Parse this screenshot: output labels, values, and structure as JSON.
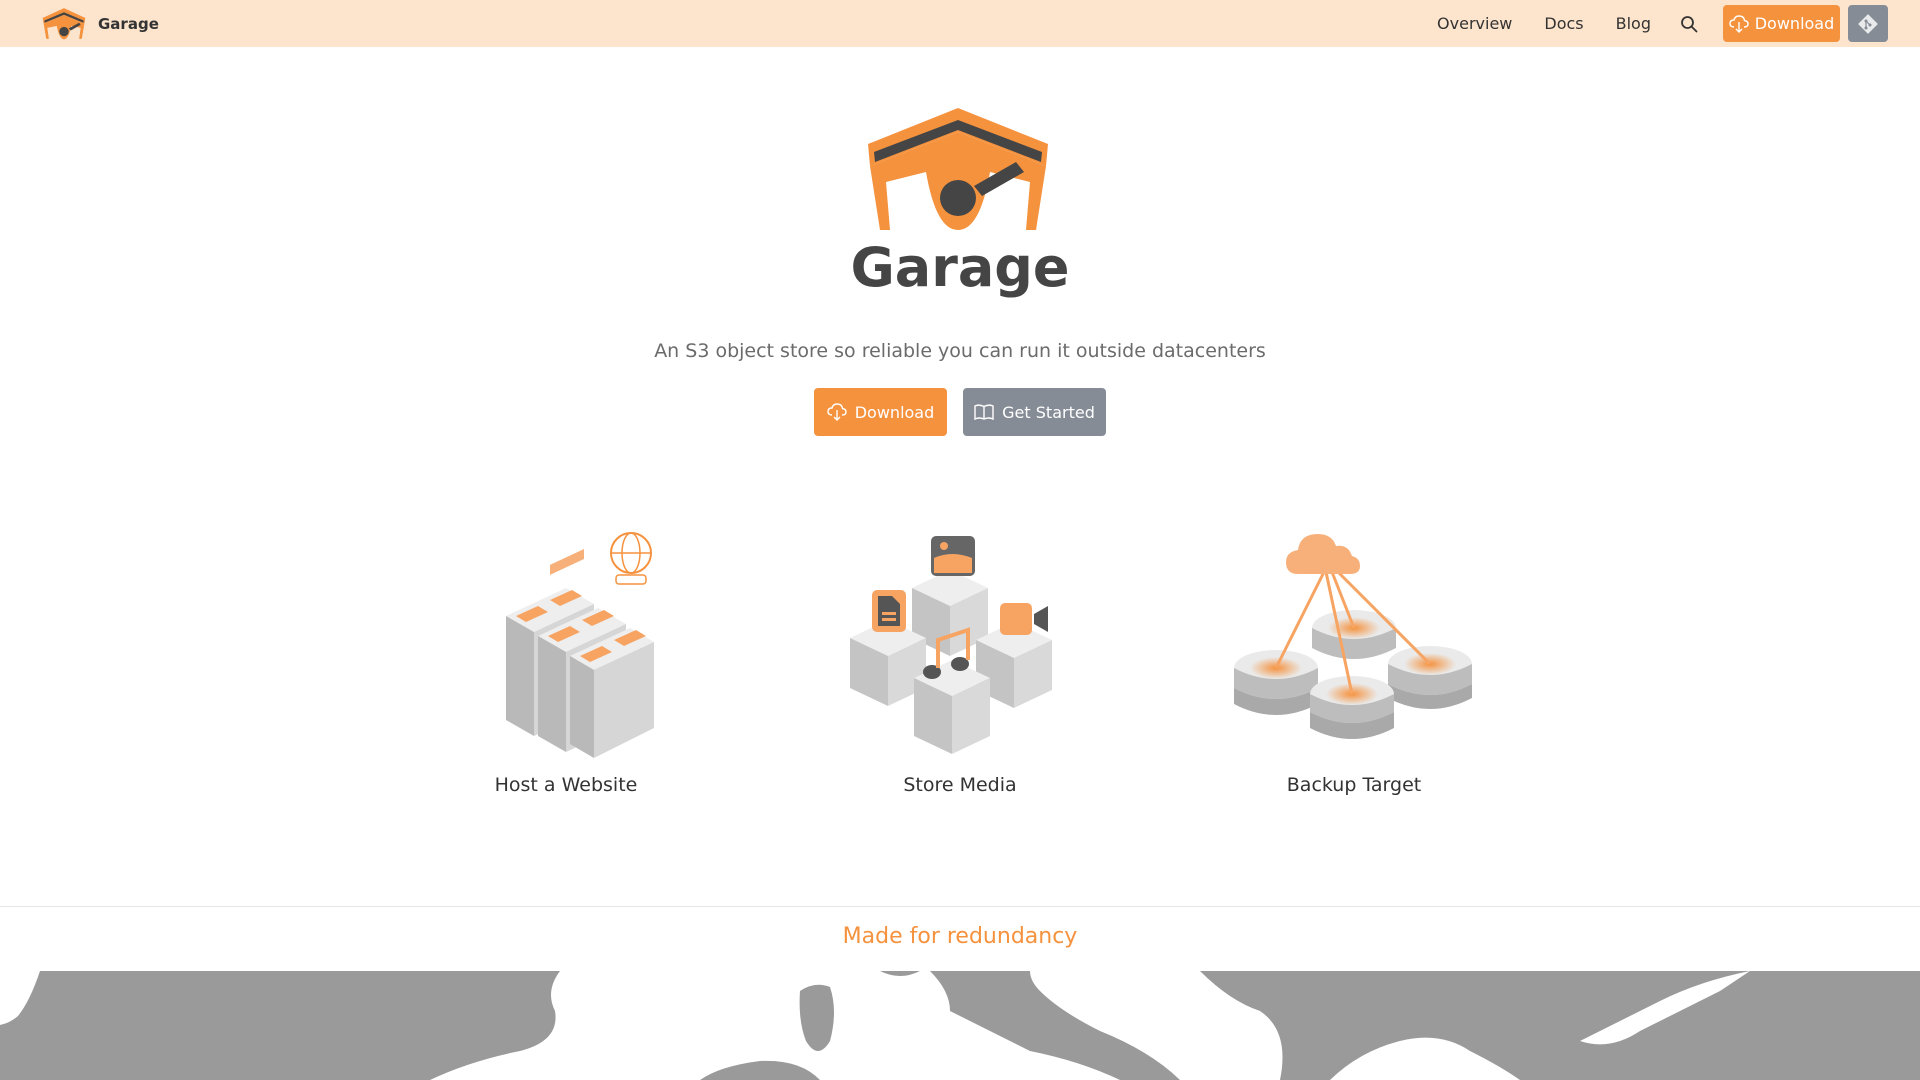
{
  "nav": {
    "brand": "Garage",
    "links": [
      "Overview",
      "Docs",
      "Blog"
    ],
    "download_label": "Download",
    "search_icon": "search-icon",
    "git_icon": "git-icon"
  },
  "hero": {
    "title": "Garage",
    "tagline": "An S3 object store so reliable you can run it outside datacenters",
    "download_label": "Download",
    "get_started_label": "Get Started"
  },
  "features": [
    {
      "label": "Host a Website",
      "icon": "servers-globe-illustration"
    },
    {
      "label": "Store Media",
      "icon": "media-cubes-illustration"
    },
    {
      "label": "Backup Target",
      "icon": "cloud-disks-illustration"
    }
  ],
  "section": {
    "title": "Made for redundancy"
  },
  "colors": {
    "accent": "#f5923e",
    "nav_bg": "#fde4cc",
    "secondary": "#868c96",
    "dark": "#454545"
  }
}
